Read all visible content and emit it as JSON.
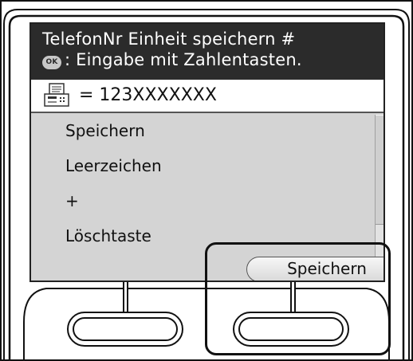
{
  "screen": {
    "title_line1": "TelefonNr Einheit speichern #",
    "title_line2": ": Eingabe mit Zahlentasten.",
    "ok_icon_label": "OK",
    "number_row": {
      "icon": "fax-icon",
      "value": "= 123XXXXXXX"
    },
    "menu_items": [
      {
        "label": "Speichern"
      },
      {
        "label": "Leerzeichen"
      },
      {
        "label": "+"
      },
      {
        "label": "Löschtaste"
      }
    ],
    "softkey_right_label": "Speichern"
  },
  "colors": {
    "title_bar": "#2b2b2b",
    "screen_bg": "#d4d4d4",
    "number_row_bg": "#ffffff"
  }
}
